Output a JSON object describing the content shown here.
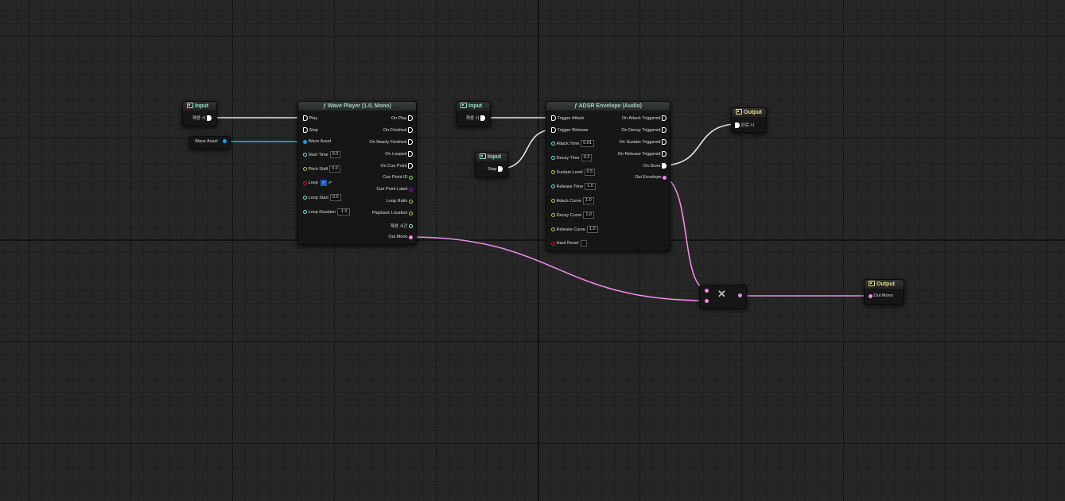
{
  "input_nodes": {
    "play_trigger": {
      "header": "Input",
      "pin": "재생 시"
    },
    "wave_asset": {
      "pin": "Wave Asset"
    },
    "adsr_play_trigger": {
      "header": "Input",
      "pin": "재생 시"
    },
    "stop_trigger": {
      "header": "Input",
      "pin": "Stop"
    }
  },
  "wave_player": {
    "title": "ƒ Wave Player (1.0, Mono)",
    "inputs": {
      "play": "Play",
      "stop": "Stop",
      "wave_asset": "Wave Asset",
      "start_time": "Start Time",
      "start_time_value": "0.0",
      "pitch_shift": "Pitch Shift",
      "pitch_shift_value": "0.0",
      "loop": "Loop",
      "loop_checked": "✓",
      "loop_reset": "↶",
      "loop_start": "Loop Start",
      "loop_start_value": "0.0",
      "loop_duration": "Loop Duration",
      "loop_duration_value": "-1.0"
    },
    "outputs": {
      "on_play": "On Play",
      "on_finished": "On Finished",
      "on_nearly_finished": "On Nearly Finished",
      "on_looped": "On Looped",
      "on_cue_point": "On Cue Point",
      "cue_point_id": "Cue Point ID",
      "cue_point_label": "Cue Point Label",
      "loop_ratio": "Loop Ratio",
      "playback_location": "Playback Location",
      "play_time": "재생 시간",
      "out_mono": "Out Mono"
    }
  },
  "adsr": {
    "title": "ƒ ADSR Envelope (Audio)",
    "inputs": {
      "trigger_attack": "Trigger Attack",
      "trigger_release": "Trigger Release",
      "attack_time": "Attack Time",
      "attack_time_value": "0.01",
      "decay_time": "Decay Time",
      "decay_time_value": "0.2",
      "sustain_level": "Sustain Level",
      "sustain_level_value": "0.5",
      "release_time": "Release Time",
      "release_time_value": "1.0",
      "attack_curve": "Attack Curve",
      "attack_curve_value": "1.0",
      "decay_curve": "Decay Curve",
      "decay_curve_value": "1.0",
      "release_curve": "Release Curve",
      "release_curve_value": "1.0",
      "hard_reset": "Hard Reset"
    },
    "outputs": {
      "on_attack_triggered": "On Attack Triggered",
      "on_decay_triggered": "On Decay Triggered",
      "on_sustain_triggered": "On Sustain Triggered",
      "on_release_triggered": "On Release Triggered",
      "on_done": "On Done",
      "out_envelope": "Out Envelope"
    }
  },
  "output_nodes": {
    "on_finished_output": {
      "header": "Output",
      "pin": "완료 시"
    },
    "out_mono_output": {
      "header": "Output",
      "pin": "Out Mono"
    }
  },
  "multiply_node": {
    "symbol": "✕"
  },
  "colors": {
    "exec_wire": "#e6e6e6",
    "wave_asset_wire": "#1fa0e0",
    "audio_wire": "#ee88e6",
    "float_pin": "#5ee3ea",
    "int_pin": "#96d84a",
    "bool_pin": "#c2201c",
    "input_header_accent": "#8fe0c8",
    "output_header_accent": "#e8d88a"
  }
}
